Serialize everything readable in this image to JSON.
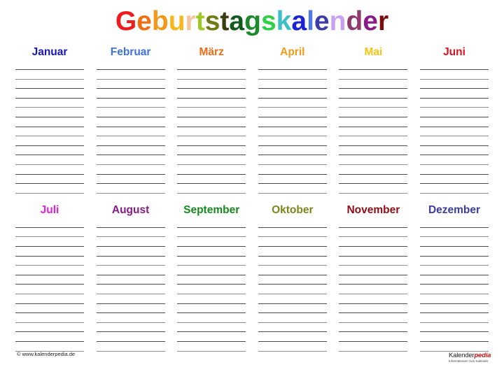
{
  "title": {
    "text": "Geburtstagskalender",
    "letters": [
      {
        "char": "G",
        "color": "#ee1c1c"
      },
      {
        "char": "e",
        "color": "#f06e12"
      },
      {
        "char": "b",
        "color": "#f3981a"
      },
      {
        "char": "u",
        "color": "#f6b61e"
      },
      {
        "char": "r",
        "color": "#f6c49c"
      },
      {
        "char": "t",
        "color": "#9dc828"
      },
      {
        "char": "s",
        "color": "#6f7c16"
      },
      {
        "char": "t",
        "color": "#3b3d10"
      },
      {
        "char": "a",
        "color": "#0f5a1c"
      },
      {
        "char": "g",
        "color": "#1d8a2c"
      },
      {
        "char": "s",
        "color": "#2fcf46"
      },
      {
        "char": "k",
        "color": "#3ebfc8"
      },
      {
        "char": "a",
        "color": "#1a22d4"
      },
      {
        "char": "l",
        "color": "#4f7ae6"
      },
      {
        "char": "e",
        "color": "#3c3ca8"
      },
      {
        "char": "n",
        "color": "#c8a2f0"
      },
      {
        "char": "d",
        "color": "#8e3a6c"
      },
      {
        "char": "e",
        "color": "#881a8a"
      },
      {
        "char": "r",
        "color": "#7c0c0c"
      }
    ]
  },
  "months": [
    {
      "name": "Januar",
      "color": "#1515c8"
    },
    {
      "name": "Februar",
      "color": "#3f6fe0"
    },
    {
      "name": "März",
      "color": "#f06a14"
    },
    {
      "name": "April",
      "color": "#f39a18"
    },
    {
      "name": "Mai",
      "color": "#f8c414"
    },
    {
      "name": "Juni",
      "color": "#e0101c"
    },
    {
      "name": "Juli",
      "color": "#e020d8"
    },
    {
      "name": "August",
      "color": "#861a86"
    },
    {
      "name": "September",
      "color": "#148a1c"
    },
    {
      "name": "Oktober",
      "color": "#7a861a"
    },
    {
      "name": "November",
      "color": "#900c14"
    },
    {
      "name": "Dezember",
      "color": "#3a3ca8"
    }
  ],
  "lines_per_month": 14,
  "footer": {
    "copyright": "© www.kalenderpedia.de",
    "logo_main": "Kalender",
    "logo_accent": "pedia",
    "logo_sub": "Informationen zum Kalender"
  }
}
